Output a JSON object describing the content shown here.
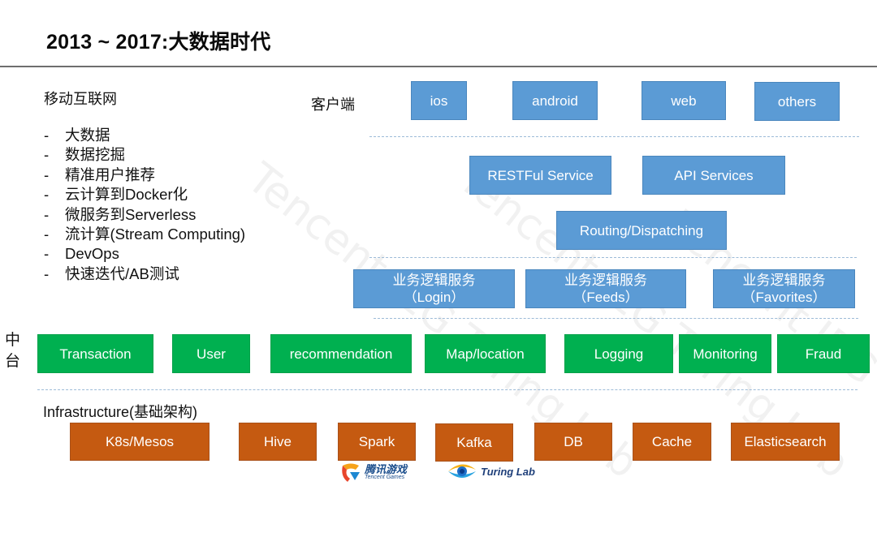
{
  "title": "2013 ~ 2017:大数据时代",
  "watermark": [
    "Tencent IEG Turing Lab",
    "Tencent IEG Turing Lab",
    "Tencent IEG Turing Lab"
  ],
  "left_panel": {
    "heading": "移动互联网",
    "bullet_marker": "-",
    "bullets": [
      "大数据",
      "数据挖掘",
      "精准用户推荐",
      "云计算到Docker化",
      "微服务到Serverless",
      "流计算(Stream Computing)",
      "DevOps",
      "快速迭代/AB测试"
    ]
  },
  "client_layer": {
    "label": "客户端",
    "items": [
      "ios",
      "android",
      "web",
      "others"
    ]
  },
  "service_layer": {
    "items": [
      "RESTFul Service",
      "API Services"
    ],
    "routing": "Routing/Dispatching"
  },
  "business_layer": {
    "items": [
      {
        "title": "业务逻辑服务",
        "sub": "（Login）"
      },
      {
        "title": "业务逻辑服务",
        "sub": "（Feeds）"
      },
      {
        "title": "业务逻辑服务",
        "sub": "（Favorites）"
      }
    ]
  },
  "middle_platform": {
    "label_top": "中",
    "label_bottom": "台",
    "items": [
      "Transaction",
      "User",
      "recommendation",
      "Map/location",
      "Logging",
      "Monitoring",
      "Fraud"
    ]
  },
  "infrastructure": {
    "label": "Infrastructure(基础架构)",
    "items": [
      "K8s/Mesos",
      "Hive",
      "Spark",
      "Kafka",
      "DB",
      "Cache",
      "Elasticsearch"
    ]
  },
  "logos": {
    "tencent_games_cn": "腾讯游戏",
    "tencent_games_en": "Tencent Games",
    "turing_lab": "Turing Lab"
  },
  "colors": {
    "client_blue": "#5b9bd5",
    "middle_green": "#00b050",
    "infra_orange": "#c55a11"
  }
}
